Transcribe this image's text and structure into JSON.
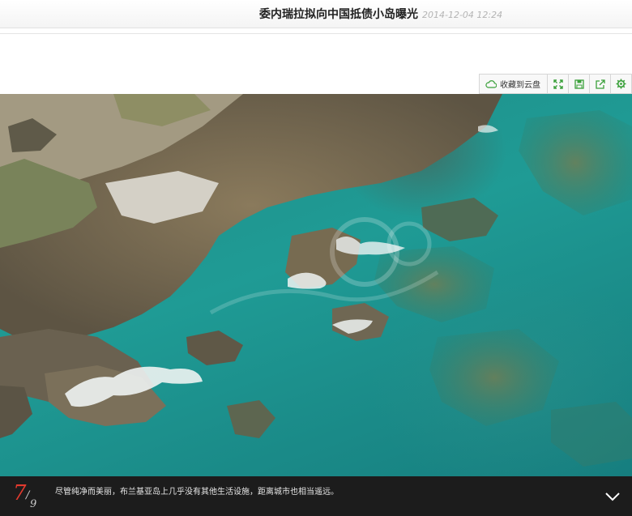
{
  "header": {
    "title": "委内瑞拉拟向中国抵债小岛曝光",
    "date": "2014-12-04 12:24"
  },
  "toolbar": {
    "save_to_cloud_label": "收藏到云盘",
    "buttons": [
      "cloud-icon",
      "fullscreen-icon",
      "save-icon",
      "share-icon",
      "settings-icon"
    ],
    "accent_color": "#3aa03a"
  },
  "gallery": {
    "current": "7",
    "separator": "/",
    "total": "9",
    "caption": "尽管纯净而美丽，布兰基亚岛上几乎没有其他生活设施，距离城市也相当遥远。",
    "counter_color": "#e33a2e"
  }
}
